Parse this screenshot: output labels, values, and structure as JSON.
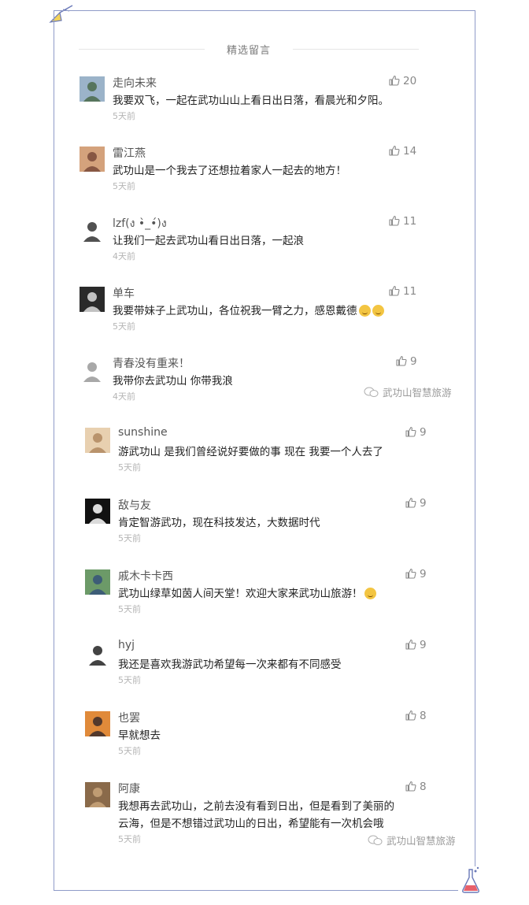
{
  "header": {
    "title": "精选留言"
  },
  "watermark_text": "武功山智慧旅游",
  "comments": [
    {
      "name": "走向未来",
      "text": "我要双飞，一起在武功山山上看日出日落，看晨光和夕阳。",
      "time": "5天前",
      "likes": "20",
      "avatar": "avatar-landscape-icon"
    },
    {
      "name": "雷江燕",
      "text": "武功山是一个我去了还想拉着家人一起去的地方！",
      "time": "5天前",
      "likes": "14",
      "avatar": "avatar-portrait-icon"
    },
    {
      "name": "lzf(ง •̀_•́)ง",
      "text": "让我们一起去武功山看日出日落，一起浪",
      "time": "4天前",
      "likes": "11",
      "avatar": "avatar-cartoon-icon"
    },
    {
      "name": "单车",
      "text": "我要带妹子上武功山，各位祝我一臂之力，感恩戴德",
      "time": "5天前",
      "likes": "11",
      "avatar": "avatar-group-icon"
    },
    {
      "name": "青春没有重来！",
      "text": "我带你去武功山 你带我浪",
      "time": "4天前",
      "likes": "9",
      "avatar": "avatar-sketch-icon"
    },
    {
      "name": "sunshine",
      "text": "游武功山  是我们曾经说好要做的事  现在  我要一个人去了",
      "time": "5天前",
      "likes": "9",
      "avatar": "avatar-girl-icon"
    },
    {
      "name": "敌与友",
      "text": "肯定智游武功，现在科技发达，大数据时代",
      "time": "5天前",
      "likes": "9",
      "avatar": "avatar-logo-icon"
    },
    {
      "name": "戚木卡卡西",
      "text": "武功山绿草如茵人间天堂！欢迎大家来武功山旅游！",
      "time": "5天前",
      "likes": "9",
      "avatar": "avatar-outdoor-icon"
    },
    {
      "name": "hyj",
      "text": "我还是喜欢我游武功希望每一次来都有不同感受",
      "time": "5天前",
      "likes": "9",
      "avatar": "avatar-face-icon"
    },
    {
      "name": "也罢",
      "text": "早就想去",
      "time": "5天前",
      "likes": "8",
      "avatar": "avatar-sunset-icon"
    },
    {
      "name": "阿康",
      "text": "我想再去武功山，之前去没有看到日出，但是看到了美丽的",
      "text2": "云海，但是不想错过武功山的日出，希望能有一次机会哦",
      "time": "5天前",
      "likes": "8",
      "avatar": "avatar-cat-icon"
    }
  ]
}
